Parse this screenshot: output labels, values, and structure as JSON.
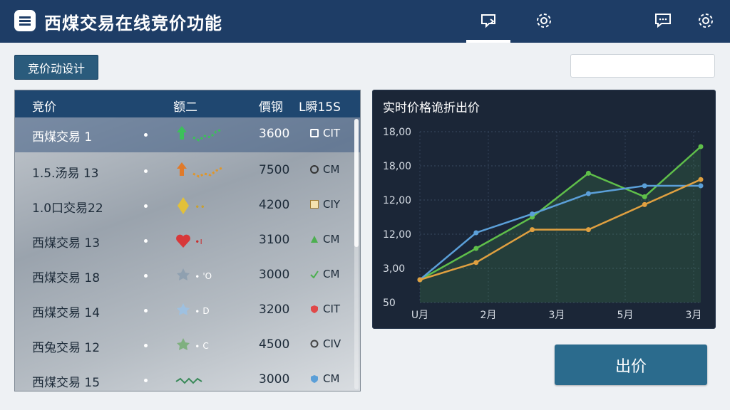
{
  "header": {
    "title": "西煤交易在线竞价功能",
    "icons": [
      "bid-tab-icon",
      "settings-icon",
      "chat-icon",
      "gear-icon"
    ]
  },
  "toolbar": {
    "filter_button": "竞价动设计",
    "search_placeholder": ""
  },
  "table": {
    "columns": [
      "竞价",
      "额二",
      "價钢",
      "L瞬15S"
    ],
    "rows": [
      {
        "name": "西煤交易 1",
        "spark": "green-up",
        "value": "3600",
        "status": "CIT",
        "status_icon": "square"
      },
      {
        "name": "1.5.汤易 13",
        "spark": "orange-up",
        "value": "7500",
        "status": "CM",
        "status_icon": "info"
      },
      {
        "name": "1.0口交易22",
        "spark": "yellow-diamond",
        "value": "4200",
        "status": "CIY",
        "status_icon": "box"
      },
      {
        "name": "西煤交易 13",
        "spark": "red-heart",
        "value": "3100",
        "status": "CM",
        "status_icon": "triangle"
      },
      {
        "name": "西煤交易 18",
        "spark": "gray-star",
        "value": "3000",
        "status": "CM",
        "status_icon": "check"
      },
      {
        "name": "西煤交易 14",
        "spark": "blue-star",
        "value": "3200",
        "status": "CIT",
        "status_icon": "shield"
      },
      {
        "name": "西兔交易 12",
        "spark": "green-star",
        "value": "4500",
        "status": "CIV",
        "status_icon": "circle"
      },
      {
        "name": "西煤交易 15",
        "spark": "green-wave",
        "value": "3000",
        "status": "CM",
        "status_icon": "shield-blue"
      }
    ]
  },
  "chart_data": {
    "type": "line",
    "title": "实时价格诡折出价",
    "categories": [
      "U月",
      "2月",
      "3月",
      "5月",
      "3月"
    ],
    "yticks": [
      "50",
      "3,00",
      "12,00",
      "12,00",
      "18,00",
      "18,00"
    ],
    "series": [
      {
        "color": "#5fbf4a",
        "values": [
          1,
          3,
          5,
          7.8,
          6.3,
          9.5
        ]
      },
      {
        "color": "#5b9fd8",
        "values": [
          1,
          4,
          5.2,
          6.5,
          7,
          7
        ]
      },
      {
        "color": "#e0a040",
        "values": [
          1,
          2.1,
          4.2,
          4.2,
          5.8,
          7.4
        ]
      }
    ],
    "grid": true
  },
  "actions": {
    "bid_button": "出价"
  },
  "colors": {
    "header_bg": "#1e3d66",
    "accent": "#2b6b8d",
    "chart_bg": "#1b2637"
  }
}
